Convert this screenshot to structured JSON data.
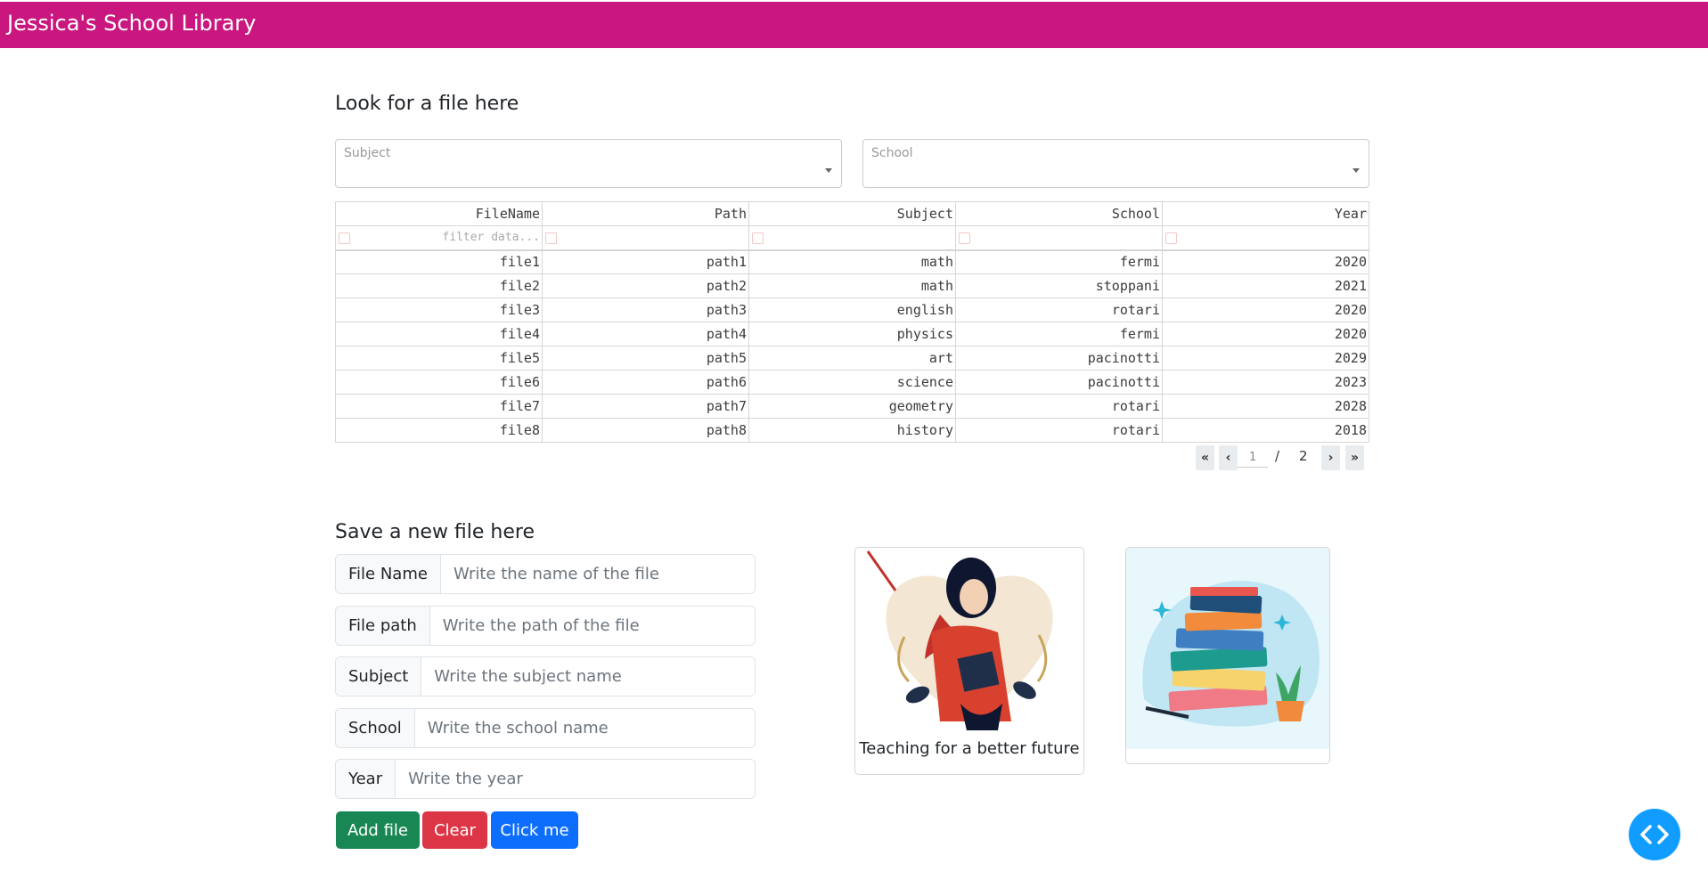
{
  "app": {
    "title": "Jessica's School Library"
  },
  "search_section": {
    "title": "Look for a file here",
    "subject_dropdown": {
      "placeholder": "Subject"
    },
    "school_dropdown": {
      "placeholder": "School"
    }
  },
  "table": {
    "columns": [
      "FileName",
      "Path",
      "Subject",
      "School",
      "Year"
    ],
    "filter_placeholder": "filter data...",
    "rows": [
      [
        "file1",
        "path1",
        "math",
        "fermi",
        "2020"
      ],
      [
        "file2",
        "path2",
        "math",
        "stoppani",
        "2021"
      ],
      [
        "file3",
        "path3",
        "english",
        "rotari",
        "2020"
      ],
      [
        "file4",
        "path4",
        "physics",
        "fermi",
        "2020"
      ],
      [
        "file5",
        "path5",
        "art",
        "pacinotti",
        "2029"
      ],
      [
        "file6",
        "path6",
        "science",
        "pacinotti",
        "2023"
      ],
      [
        "file7",
        "path7",
        "geometry",
        "rotari",
        "2028"
      ],
      [
        "file8",
        "path8",
        "history",
        "rotari",
        "2018"
      ]
    ]
  },
  "pagination": {
    "current_page": "1",
    "separator": "/",
    "total_pages": "2"
  },
  "save_section": {
    "title": "Save a new file here",
    "fields": {
      "file_name": {
        "label": "File Name",
        "placeholder": "Write the name of the file"
      },
      "file_path": {
        "label": "File path",
        "placeholder": "Write the path of the file"
      },
      "subject": {
        "label": "Subject",
        "placeholder": "Write the subject name"
      },
      "school": {
        "label": "School",
        "placeholder": "Write the school name"
      },
      "year": {
        "label": "Year",
        "placeholder": "Write the year"
      }
    },
    "buttons": {
      "add": "Add file",
      "clear": "Clear",
      "click": "Click me"
    }
  },
  "cards": {
    "teacher_caption": "Teaching for a better future"
  },
  "colors": {
    "navbar": "#c9177f",
    "add_button": "#198754",
    "clear_button": "#dc3545",
    "click_button": "#0d6efd",
    "debug_button": "#119dff"
  },
  "icons": {
    "first_page": "double-chevron-left-icon",
    "prev_page": "chevron-left-icon",
    "next_page": "chevron-right-icon",
    "last_page": "double-chevron-right-icon",
    "debug": "code-brackets-icon"
  }
}
